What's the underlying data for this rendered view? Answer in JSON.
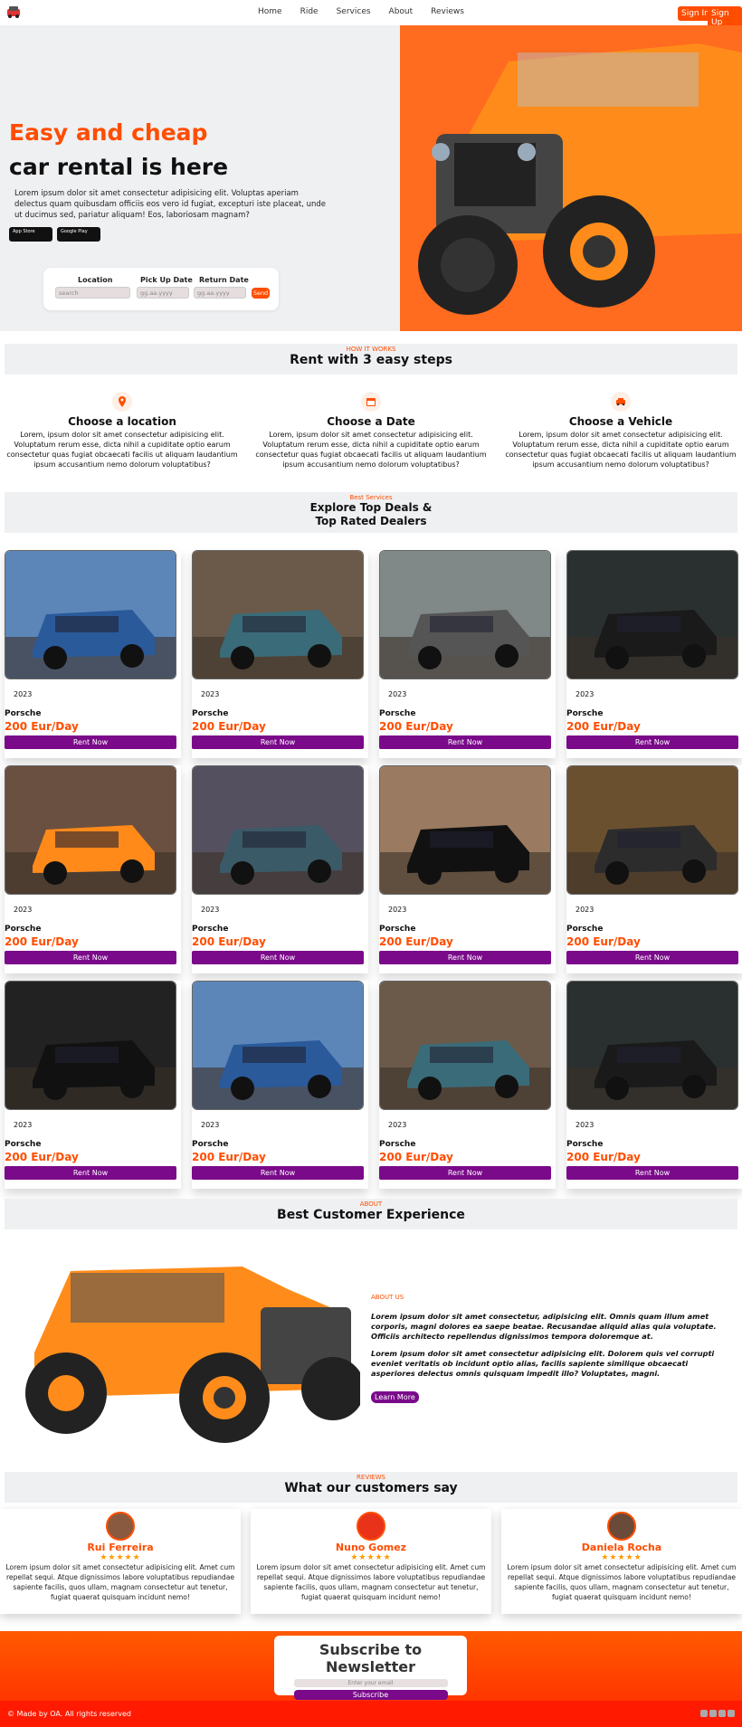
{
  "nav": {
    "items": [
      "Home",
      "Ride",
      "Services",
      "About",
      "Reviews"
    ],
    "sign_in": "Sign In",
    "sign_up": "Sign Up"
  },
  "hero": {
    "title_line1": "Easy and cheap",
    "title_line2": "car rental is here",
    "paragraph": "Lorem ipsum dolor sit amet consectetur adipisicing elit. Voluptas aperiam delectus quam quibusdam officiis eos vero id fugiat, excepturi iste placeat, unde ut ducimus sed, pariatur aliquam! Eos, laboriosam magnam?",
    "app_store": "App Store",
    "google_play": "Google Play"
  },
  "booking": {
    "location_label": "Location",
    "location_placeholder": "search",
    "pickup_label": "Pick Up Date",
    "pickup_value": "gg.aa.yyyy",
    "return_label": "Return Date",
    "return_value": "gg.aa.yyyy",
    "send": "Send"
  },
  "how": {
    "eyebrow": "HOW IT WORKS",
    "title": "Rent with 3 easy steps",
    "steps": [
      {
        "title": "Choose a location",
        "text": "Lorem, ipsum dolor sit amet consectetur adipisicing elit. Voluptatum rerum esse, dicta nihil a cupiditate optio earum consectetur quas fugiat obcaecati facilis ut aliquam laudantium ipsum accusantium nemo dolorum voluptatibus?"
      },
      {
        "title": "Choose a Date",
        "text": "Lorem, ipsum dolor sit amet consectetur adipisicing elit. Voluptatum rerum esse, dicta nihil a cupiditate optio earum consectetur quas fugiat obcaecati facilis ut aliquam laudantium ipsum accusantium nemo dolorum voluptatibus?"
      },
      {
        "title": "Choose a Vehicle",
        "text": "Lorem, ipsum dolor sit amet consectetur adipisicing elit. Voluptatum rerum esse, dicta nihil a cupiditate optio earum consectetur quas fugiat obcaecati facilis ut aliquam laudantium ipsum accusantium nemo dolorum voluptatibus?"
      }
    ]
  },
  "deals": {
    "eyebrow": "Best Services",
    "title_line1": "Explore Top Deals &",
    "title_line2": "Top Rated Dealers",
    "card": {
      "year": "2023",
      "make": "Porsche",
      "price": "200 Eur/Day",
      "button": "Rent Now"
    },
    "car_colors": [
      "#2a5a9a",
      "#3a6b78",
      "#555",
      "#1a1a1a",
      "#ff8a1a",
      "#3b5a68",
      "#111",
      "#2c2c2c",
      "#111",
      "#2a5a9a",
      "#3a6b78",
      "#1a1a1a"
    ],
    "sky_colors": [
      "#5c86b8",
      "#6b5a4a",
      "#808888",
      "#2a3030",
      "#6a5040",
      "#555060",
      "#9a7a60",
      "#6b5030",
      "#222",
      "#5c86b8",
      "#6b5a4a",
      "#2a3030"
    ]
  },
  "about": {
    "eyebrow": "ABOUT",
    "title": "Best Customer Experience",
    "label": "ABOUT US",
    "p1": "Lorem ipsum dolor sit amet consectetur, adipisicing elit. Omnis quam illum amet corporis, magni dolores ea saepe beatae. Recusandae aliquid alias quia voluptate. Officiis architecto repellendus dignissimos tempora doloremque at.",
    "p2": "Lorem ipsum dolor sit amet consectetur adipisicing elit. Dolorem quis vel corrupti eveniet veritatis ob incidunt optio alias, facilis sapiente similique obcaecati asperiores delectus omnis quisquam impedit illo? Voluptates, magni.",
    "button": "Learn More"
  },
  "reviews": {
    "eyebrow": "REVIEWS",
    "title": "What our customers say",
    "items": [
      {
        "name": "Rui Ferreira",
        "stars": "★★★★★",
        "text": "Lorem ipsum dolor sit amet consectetur adipisicing elit. Amet cum repellat sequi. Atque dignissimos labore voluptatibus repudiandae sapiente facilis, quos ullam, magnam consectetur aut tenetur, fugiat quaerat quisquam incidunt nemo!"
      },
      {
        "name": "Nuno Gomez",
        "stars": "★★★★★",
        "text": "Lorem ipsum dolor sit amet consectetur adipisicing elit. Amet cum repellat sequi. Atque dignissimos labore voluptatibus repudiandae sapiente facilis, quos ullam, magnam consectetur aut tenetur, fugiat quaerat quisquam incidunt nemo!"
      },
      {
        "name": "Daniela Rocha",
        "stars": "★★★★★",
        "text": "Lorem ipsum dolor sit amet consectetur adipisicing elit. Amet cum repellat sequi. Atque dignissimos labore voluptatibus repudiandae sapiente facilis, quos ullam, magnam consectetur aut tenetur, fugiat quaerat quisquam incidunt nemo!"
      }
    ]
  },
  "newsletter": {
    "title": "Subscribe to Newsletter",
    "placeholder": "Enter your email",
    "button": "Subscribe"
  },
  "footer": {
    "text": "© Made by OA. All rights reserved"
  }
}
